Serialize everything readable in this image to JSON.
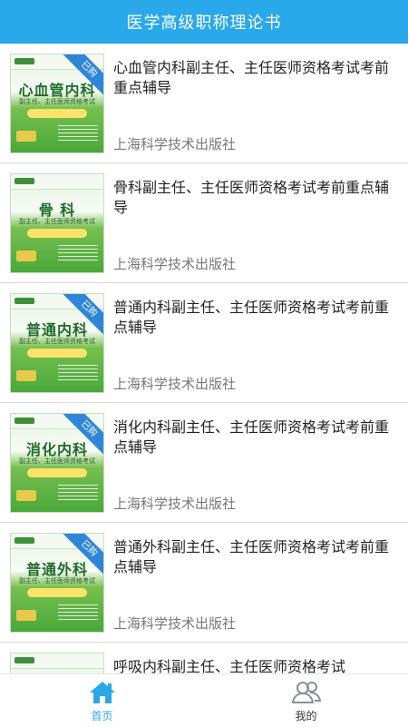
{
  "header": {
    "title": "医学高级职称理论书"
  },
  "books": [
    {
      "title": "心血管内科副主任、主任医师资格考试考前重点辅导",
      "cover_title": "心血管内科",
      "cover_subtitle": "副主任、主任医师资格考试",
      "publisher": "上海科学技术出版社",
      "badge": "已购",
      "purchased": true
    },
    {
      "title": "骨科副主任、主任医师资格考试考前重点辅导",
      "cover_title": "骨 科",
      "cover_subtitle": "副主任、主任医师资格考试",
      "publisher": "上海科学技术出版社",
      "badge": "",
      "purchased": false
    },
    {
      "title": "普通内科副主任、主任医师资格考试考前重点辅导",
      "cover_title": "普通内科",
      "cover_subtitle": "副主任、主任医师资格考试",
      "publisher": "上海科学技术出版社",
      "badge": "已购",
      "purchased": true
    },
    {
      "title": "消化内科副主任、主任医师资格考试考前重点辅导",
      "cover_title": "消化内科",
      "cover_subtitle": "副主任、主任医师资格考试",
      "publisher": "上海科学技术出版社",
      "badge": "已购",
      "purchased": true
    },
    {
      "title": "普通外科副主任、主任医师资格考试考前重点辅导",
      "cover_title": "普通外科",
      "cover_subtitle": "副主任、主任医师资格考试",
      "publisher": "上海科学技术出版社",
      "badge": "已购",
      "purchased": true
    },
    {
      "title": "呼吸内科副主任、主任医师资格考试",
      "cover_title": "",
      "cover_subtitle": "",
      "publisher": "",
      "badge": "",
      "purchased": false
    }
  ],
  "tabbar": {
    "tabs": [
      {
        "label": "首页",
        "icon": "home-icon",
        "active": true
      },
      {
        "label": "我的",
        "icon": "users-icon",
        "active": false
      }
    ],
    "active_color": "#29a8ea",
    "inactive_color": "#333333"
  },
  "colors": {
    "header_bg": "#29a8ea",
    "badge_bg": "#2f86d9"
  }
}
